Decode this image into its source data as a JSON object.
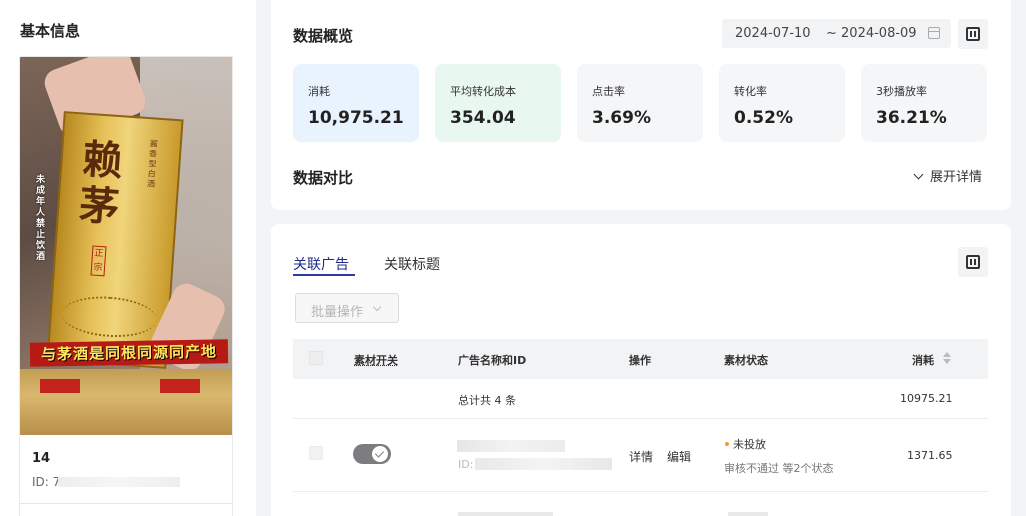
{
  "left": {
    "title": "基本信息",
    "video": {
      "overlay_text_vertical": "未成年人禁止饮酒",
      "box_big_text": "赖茅",
      "box_seal": "正宗",
      "box_side_text": "酱香型白酒",
      "banner_text": "与茅酒是同根同源同产地",
      "number": "14",
      "id_label": "ID: 7"
    }
  },
  "overview": {
    "title": "数据概览",
    "date_start": "2024-07-10",
    "date_end": "~ 2024-08-09",
    "metrics": [
      {
        "label": "消耗",
        "value": "10,975.21",
        "bg": "#e8f3fd"
      },
      {
        "label": "平均转化成本",
        "value": "354.04",
        "bg": "#e8f7ef"
      },
      {
        "label": "点击率",
        "value": "3.69%",
        "bg": "#f5f6f8"
      },
      {
        "label": "转化率",
        "value": "0.52%",
        "bg": "#f5f6f8"
      },
      {
        "label": "3秒播放率",
        "value": "36.21%",
        "bg": "#f5f6f8"
      }
    ],
    "compare_title": "数据对比",
    "expand_label": "展开详情"
  },
  "related": {
    "tabs": [
      "关联广告",
      "关联标题"
    ],
    "batch_label": "批量操作",
    "columns": [
      "素材开关",
      "广告名称和ID",
      "操作",
      "素材状态",
      "消耗"
    ],
    "total_label": "总计共 4 条",
    "total_cost": "10975.21",
    "rows": [
      {
        "id_prefix": "ID: 7",
        "actions": [
          "详情",
          "编辑"
        ],
        "status": "未投放",
        "status_sub": "审核不通过 等2个状态",
        "cost": "1371.65",
        "toggle_on": true
      }
    ]
  }
}
